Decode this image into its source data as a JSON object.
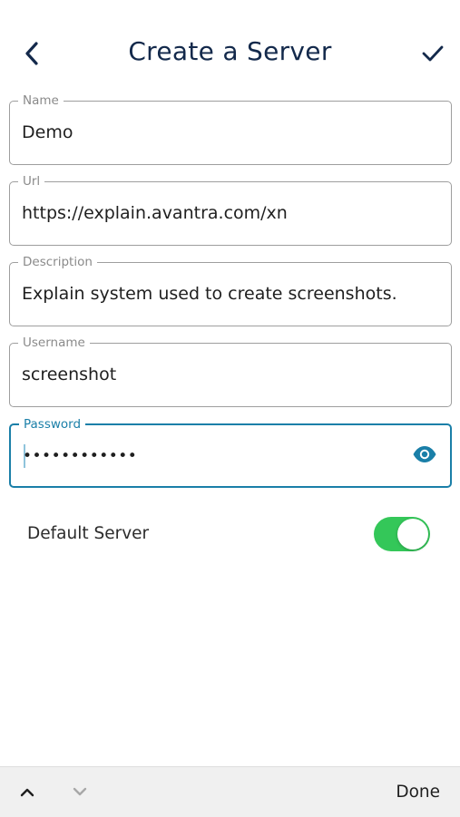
{
  "header": {
    "title": "Create a Server",
    "back_icon": "chevron-left-icon",
    "confirm_icon": "checkmark-icon"
  },
  "form": {
    "name": {
      "label": "Name",
      "value": "Demo"
    },
    "url": {
      "label": "Url",
      "value": "https://explain.avantra.com/xn"
    },
    "description": {
      "label": "Description",
      "value": "Explain system used to create screenshots."
    },
    "username": {
      "label": "Username",
      "value": "screenshot"
    },
    "password": {
      "label": "Password",
      "masked_value": "••••••••••••",
      "visibility_icon": "eye-icon"
    }
  },
  "default_server": {
    "label": "Default Server",
    "enabled": true
  },
  "keyboard_toolbar": {
    "prev_icon": "chevron-up-icon",
    "next_icon": "chevron-down-icon",
    "done_label": "Done"
  },
  "colors": {
    "title": "#13294b",
    "accent": "#1a7fa8",
    "toggle_on": "#34c759"
  }
}
